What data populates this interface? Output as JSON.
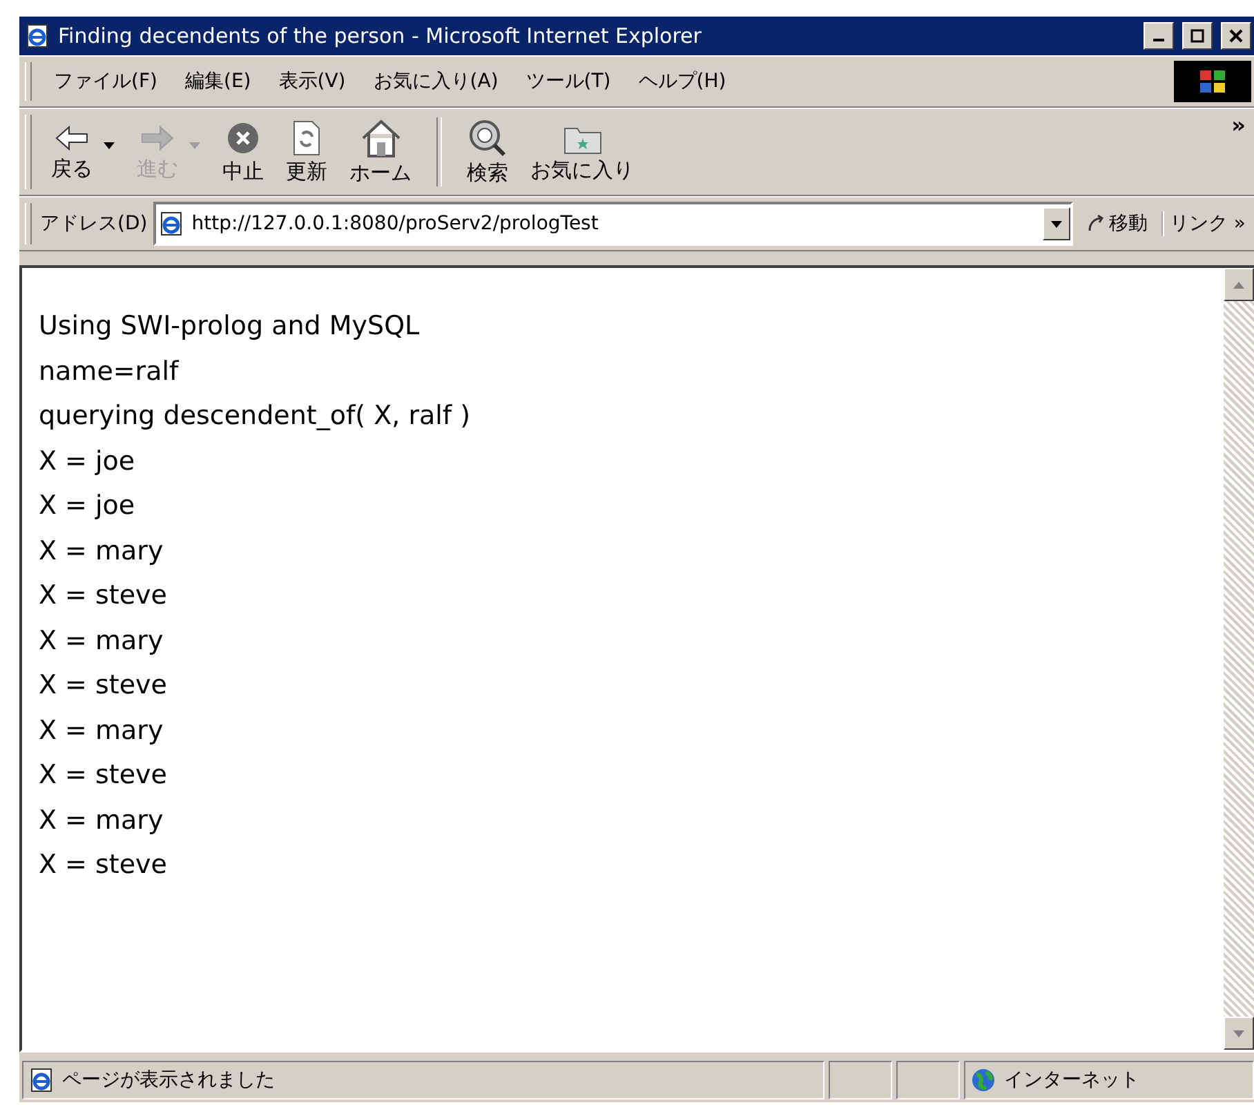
{
  "window": {
    "title": "Finding decendents of the person - Microsoft Internet Explorer"
  },
  "menu": [
    "ファイル(F)",
    "編集(E)",
    "表示(V)",
    "お気に入り(A)",
    "ツール(T)",
    "ヘルプ(H)"
  ],
  "toolbar": [
    {
      "kind": "back",
      "label": "戻る",
      "disabled": false,
      "dropdown": true
    },
    {
      "kind": "forward",
      "label": "進む",
      "disabled": true,
      "dropdown": true
    },
    {
      "kind": "stop",
      "label": "中止",
      "disabled": false,
      "dropdown": false
    },
    {
      "kind": "refresh",
      "label": "更新",
      "disabled": false,
      "dropdown": false
    },
    {
      "kind": "home",
      "label": "ホーム",
      "disabled": false,
      "dropdown": false
    },
    {
      "kind": "search",
      "label": "検索",
      "disabled": false,
      "dropdown": false
    },
    {
      "kind": "favorites",
      "label": "お気に入り",
      "disabled": false,
      "dropdown": false
    }
  ],
  "chevron": "»",
  "address": {
    "label": "アドレス(D)",
    "value": "http://127.0.0.1:8080/proServ2/prologTest",
    "go": "移動",
    "links": "リンク",
    "links_chevron": "»"
  },
  "content": [
    "Using SWI-prolog and MySQL",
    "name=ralf",
    "querying descendent_of( X, ralf )",
    "X = joe",
    "X = joe",
    "X = mary",
    "X = steve",
    "X = mary",
    "X = steve",
    "X = mary",
    "X = steve",
    "X = mary",
    "X = steve"
  ],
  "status": {
    "text": "ページが表示されました",
    "zone": "インターネット"
  }
}
